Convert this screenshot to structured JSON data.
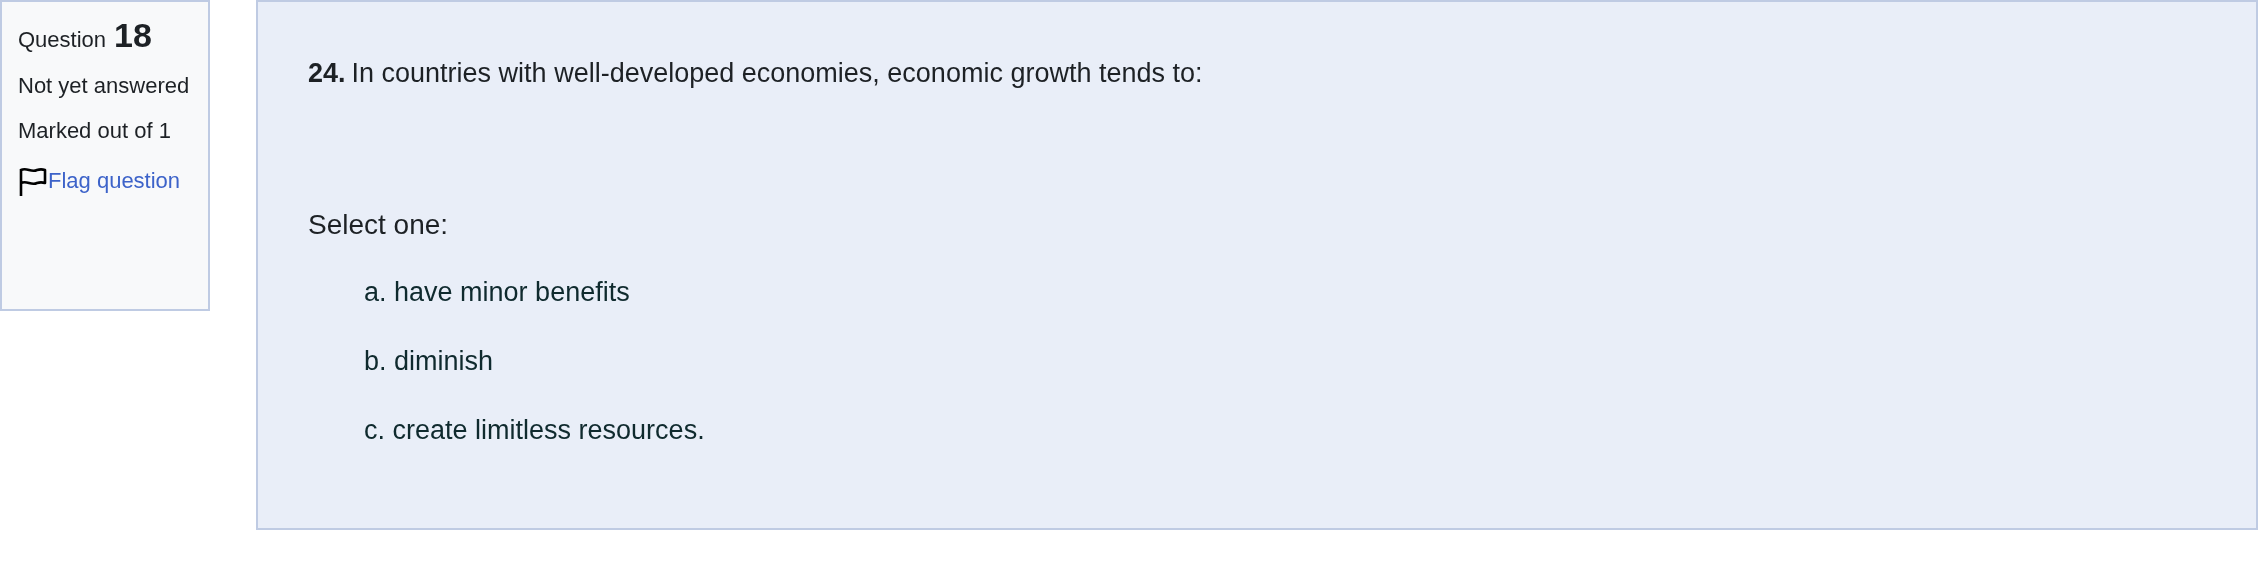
{
  "info": {
    "question_label": "Question",
    "question_number": "18",
    "status": "Not yet answered",
    "marks": "Marked out of 1",
    "flag_link": "Flag question"
  },
  "question": {
    "number": "24.",
    "text": "In countries with well-developed economies, economic growth tends to:",
    "prompt": "Select one:",
    "options": [
      {
        "letter": "a.",
        "text": "have minor benefits"
      },
      {
        "letter": "b.",
        "text": "diminish"
      },
      {
        "letter": "c.",
        "text": "create limitless resources."
      }
    ]
  }
}
